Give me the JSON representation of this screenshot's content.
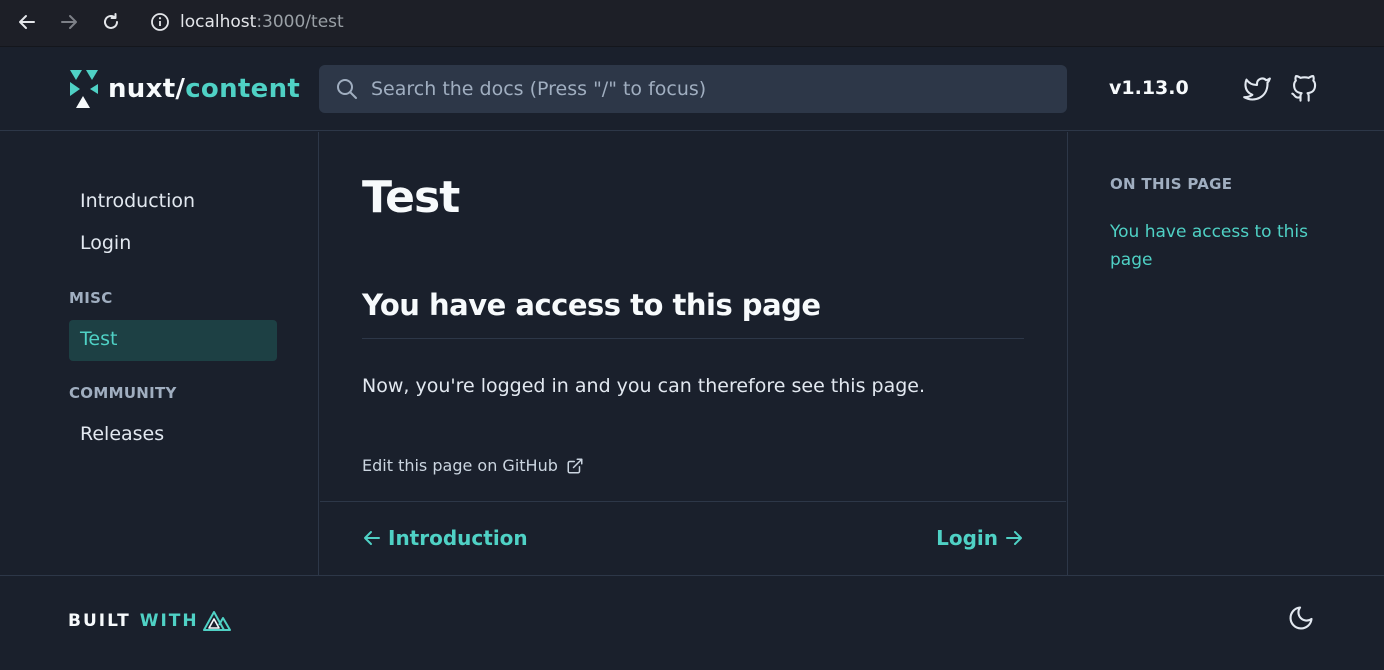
{
  "browser": {
    "url_host": "localhost",
    "url_path": ":3000/test"
  },
  "header": {
    "logo_primary": "nuxt/",
    "logo_accent": "content",
    "search_placeholder": "Search the docs (Press \"/\" to focus)",
    "version": "v1.13.0"
  },
  "sidebar": {
    "items": [
      {
        "label": "Introduction"
      },
      {
        "label": "Login"
      }
    ],
    "categories": [
      {
        "title": "MISC",
        "items": [
          {
            "label": "Test",
            "active": true
          }
        ]
      },
      {
        "title": "COMMUNITY",
        "items": [
          {
            "label": "Releases"
          }
        ]
      }
    ]
  },
  "main": {
    "title": "Test",
    "heading": "You have access to this page",
    "paragraph": "Now, you're logged in and you can therefore see this page.",
    "edit_link": "Edit this page on GitHub",
    "prev_label": "Introduction",
    "next_label": "Login"
  },
  "toc": {
    "title": "ON THIS PAGE",
    "links": [
      {
        "label": "You have access to this page"
      }
    ]
  },
  "footer": {
    "built_word": "BUILT",
    "with_word": "WITH"
  },
  "colors": {
    "accent": "#4fd1c5",
    "background": "#1a202c",
    "active_bg": "#1d4044"
  }
}
